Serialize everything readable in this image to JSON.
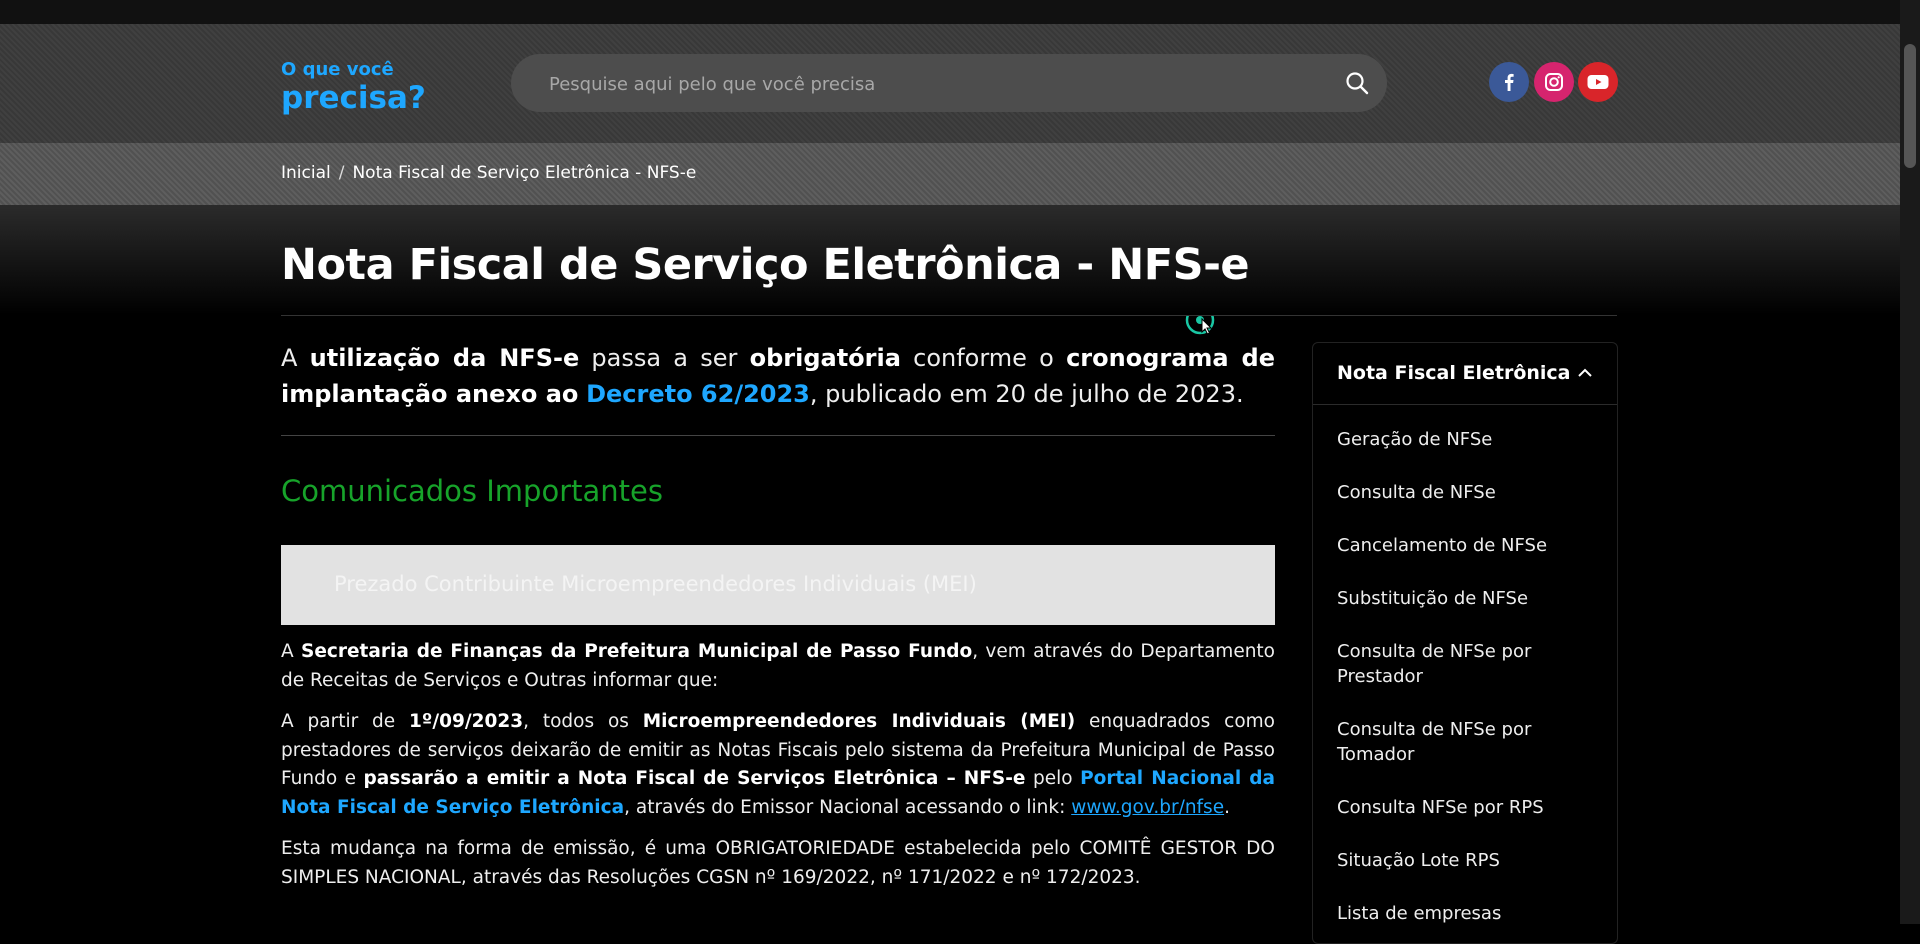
{
  "header": {
    "brand_small": "O que você",
    "brand_big": "precisa?",
    "search_placeholder": "Pesquise aqui pelo que você precisa",
    "social": [
      {
        "icon": "facebook-icon",
        "color": "#3b5998"
      },
      {
        "icon": "instagram-icon",
        "color": "#d6246e"
      },
      {
        "icon": "youtube-icon",
        "color": "#d9252a"
      }
    ]
  },
  "breadcrumb": {
    "home": "Inicial",
    "separator": "/",
    "current": "Nota Fiscal de Serviço Eletrônica - NFS-e"
  },
  "page": {
    "title": "Nota Fiscal de Serviço Eletrônica - NFS-e"
  },
  "lead": {
    "t1": "A ",
    "b1": "utilização da NFS-e",
    "t2": " passa a ser ",
    "b2": "obrigatória",
    "t3": " conforme o ",
    "b3": "cronograma de implantação anexo ao",
    "t4": " ",
    "link": "Decreto 62/2023",
    "t5": ", publicado em 20 de julho de 2023."
  },
  "section": {
    "title": "Comunicados Importantes",
    "notice": "Prezado Contribuinte Microempreendedores Individuais (MEI)"
  },
  "p1": {
    "t1": "A ",
    "b1": "Secretaria de Finanças da Prefeitura Municipal de Passo Fundo",
    "t2": ", vem através do Departamento de Receitas de Serviços e Outras informar que:"
  },
  "p2": {
    "t1": "A partir de ",
    "b1": "1º/09/2023",
    "t2": ", todos os ",
    "b2": "Microempreendedores Individuais (MEI)",
    "t3": " enquadrados como prestadores de serviços deixarão de emitir as Notas Fiscais pelo sistema da Prefeitura Municipal de Passo Fundo e ",
    "b3": "passarão a emitir a Nota Fiscal de Serviços Eletrônica – NFS-e",
    "t4": " pelo ",
    "link": "Portal Nacional da Nota Fiscal de Serviço Eletrônica",
    "t5": ", através do Emissor Nacional acessando o link: ",
    "url": "www.gov.br/nfse",
    "t6": "."
  },
  "p3": {
    "text": "Esta mudança na forma de emissão, é uma OBRIGATORIEDADE estabelecida pelo COMITÊ GESTOR DO SIMPLES NACIONAL, através das Resoluções CGSN nº 169/2022, nº 171/2022 e nº 172/2023."
  },
  "sidebar": {
    "title": "Nota Fiscal Eletrônica",
    "items": [
      "Geração de NFSe",
      "Consulta de NFSe",
      "Cancelamento de NFSe",
      "Substituição de NFSe",
      "Consulta de NFSe por Prestador",
      "Consulta de NFSe por Tomador",
      "Consulta NFSe por RPS",
      "Situação Lote RPS",
      "Lista de empresas"
    ]
  }
}
